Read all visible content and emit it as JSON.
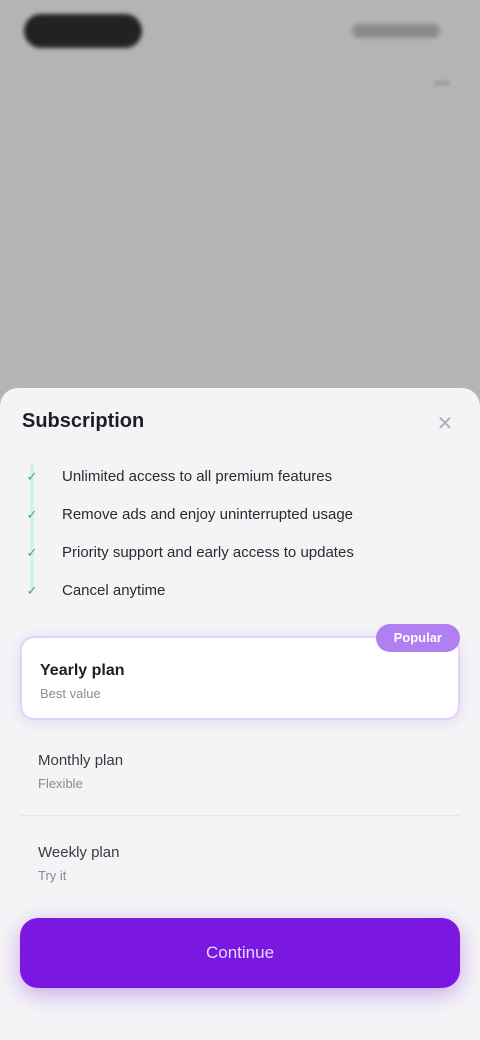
{
  "background": {
    "logo_icon": "app-logo",
    "accent": "#7a17e0"
  },
  "sheet": {
    "title": "Subscription",
    "close_icon": "close-icon",
    "benefits": [
      "Unlimited access to all premium features",
      "Remove ads and enjoy uninterrupted usage",
      "Priority support and early access to updates",
      "Cancel anytime"
    ],
    "plans": [
      {
        "name": "Yearly plan",
        "sub": "Best value",
        "price": "",
        "badge": "Popular",
        "selected": true
      },
      {
        "name": "Monthly plan",
        "sub": "Flexible",
        "price": "",
        "selected": false
      },
      {
        "name": "Weekly plan",
        "sub": "Try it",
        "price": "",
        "selected": false
      }
    ],
    "cta_label": "Continue"
  }
}
